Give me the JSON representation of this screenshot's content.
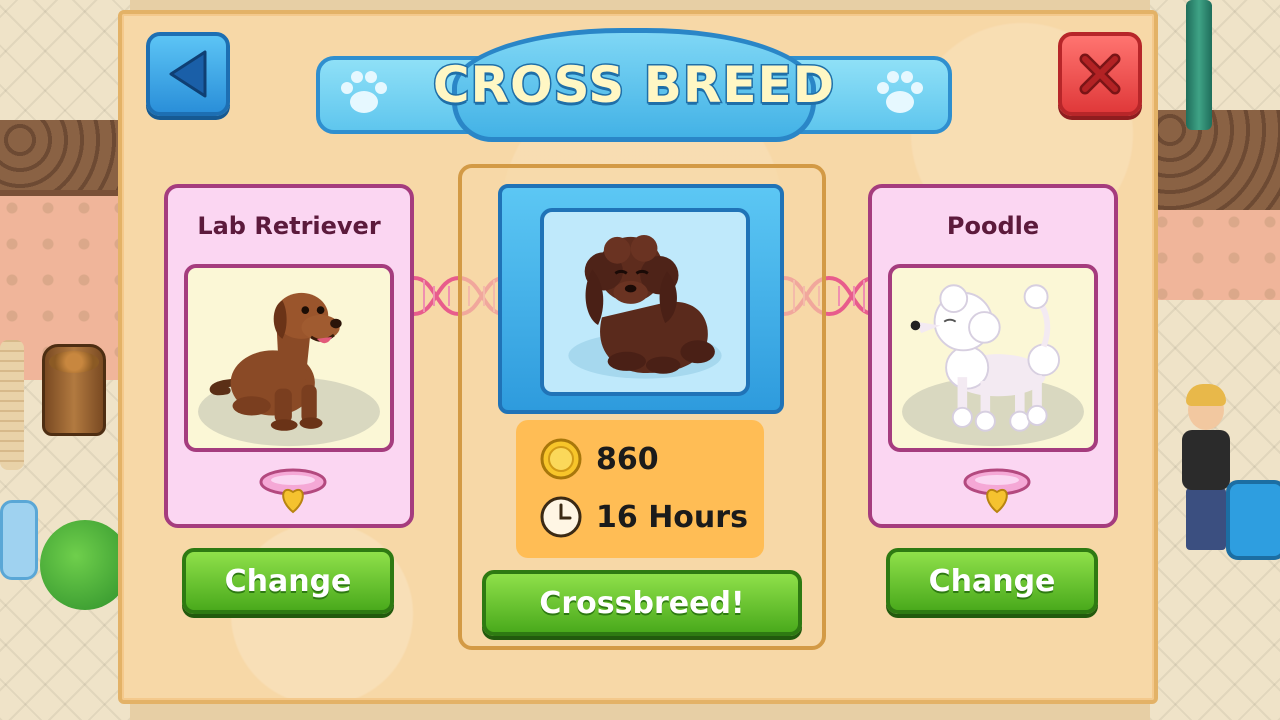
{
  "title": "CROSS BREED",
  "left_dog": {
    "name": "Lab Retriever",
    "change_label": "Change"
  },
  "right_dog": {
    "name": "Poodle",
    "change_label": "Change"
  },
  "result": {
    "cost_coins": "860",
    "duration": "16 Hours",
    "action_label": "Crossbreed!"
  },
  "icons": {
    "back": "back-arrow-icon",
    "close": "close-x-icon",
    "paw": "paw-icon",
    "coin": "coin-icon",
    "clock": "clock-icon",
    "collar": "collar-icon",
    "dna": "dna-icon"
  },
  "colors": {
    "panel_bg": "#f7d8a7",
    "banner_blue": "#43b2e6",
    "card_pink": "#fbd6f2",
    "card_border": "#a53c7e",
    "button_green": "#4aaa1c",
    "close_red": "#e0393a",
    "cost_orange": "#ffbd55"
  }
}
